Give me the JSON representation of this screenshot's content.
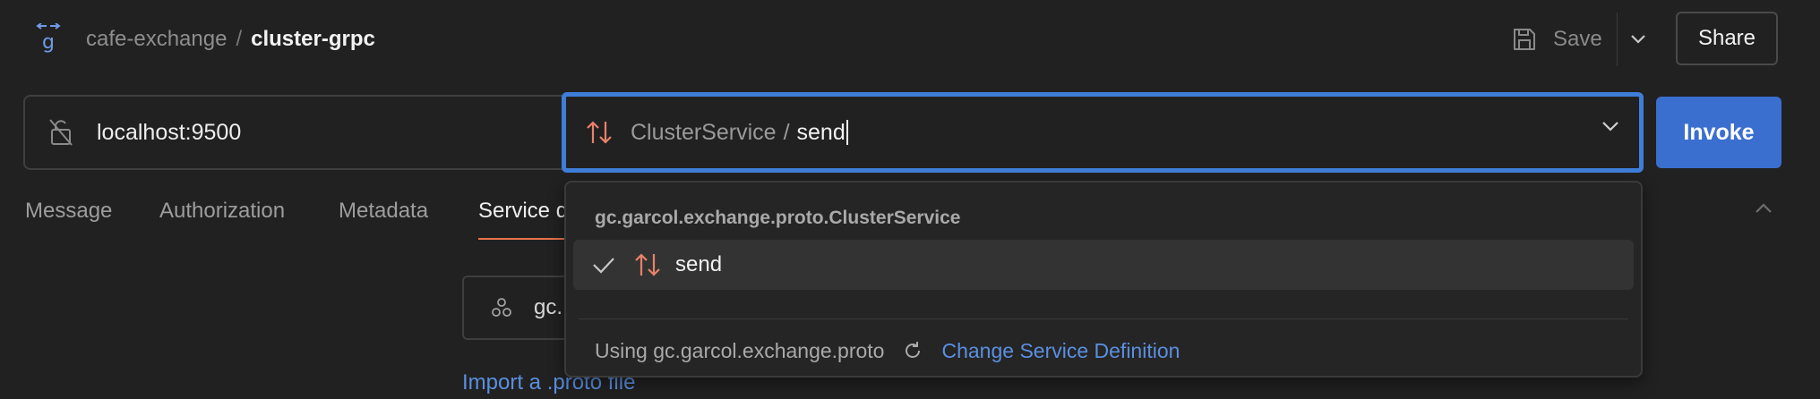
{
  "breadcrumb": {
    "workspace": "cafe-exchange",
    "separator": "/",
    "request": "cluster-grpc"
  },
  "toolbar": {
    "save_label": "Save",
    "share_label": "Share"
  },
  "request": {
    "url": "localhost:9500",
    "service": "ClusterService",
    "separator": "/",
    "method": "send",
    "invoke_label": "Invoke"
  },
  "tabs": [
    {
      "label": "Message"
    },
    {
      "label": "Authorization"
    },
    {
      "label": "Metadata"
    },
    {
      "label": "Service d"
    }
  ],
  "body": {
    "service_definition_partial": "gc.",
    "import_link": "Import a .proto file"
  },
  "dropdown": {
    "group_label": "gc.garcol.exchange.proto.ClusterService",
    "items": [
      {
        "label": "send",
        "selected": true
      }
    ],
    "footer_using": "Using gc.garcol.exchange.proto",
    "change_label": "Change Service Definition"
  },
  "icons": {
    "logo": "grpc-logo-icon",
    "save": "floppy-disk-icon",
    "save_caret": "chevron-down-icon",
    "url_lock": "unlocked-icon",
    "method": "streaming-arrows-icon",
    "method_caret": "chevron-down-icon",
    "collapse": "chevron-up-icon",
    "service_def": "cluster-nodes-icon",
    "check": "checkmark-icon",
    "refresh": "refresh-icon"
  },
  "colors": {
    "background": "#212121",
    "accent_blue": "#3a6fd0",
    "focus_border": "#3f7ed8",
    "link_blue": "#5b8fe0",
    "method_icon": "#e8826a",
    "tab_underline": "#e8734a"
  }
}
